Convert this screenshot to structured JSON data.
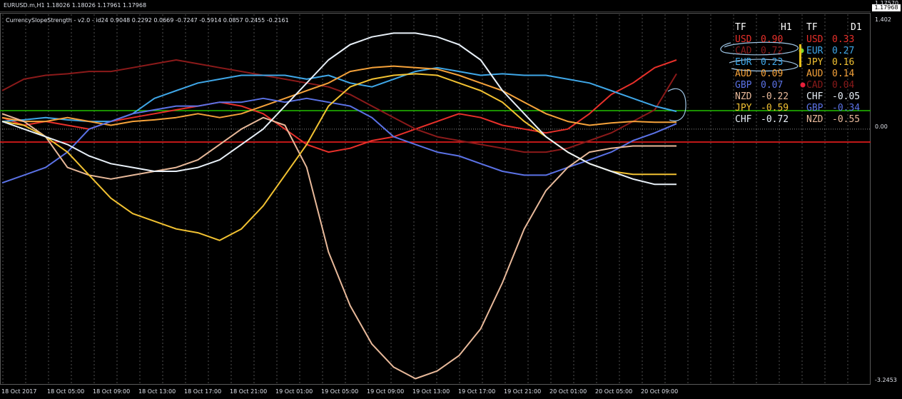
{
  "header": {
    "symbol_line": "EURUSD.m,H1  1.18026 1.18026 1.17961 1.17968",
    "current_price": "1.17968",
    "upper_scale_label": "1.17570"
  },
  "indicator": {
    "title": "CurrencySlopeStrength - v2.0 - id24 0.9048 0.2292 0.0669 -0.7247 -0.5914 0.0857 0.2455 -0.2161",
    "scale_top": "1.402",
    "scale_zero": "0.00",
    "scale_bottom": "-3.2453"
  },
  "time_axis": [
    "18 Oct 2017",
    "18 Oct 05:00",
    "18 Oct 09:00",
    "18 Oct 13:00",
    "18 Oct 17:00",
    "18 Oct 21:00",
    "19 Oct 01:00",
    "19 Oct 05:00",
    "19 Oct 09:00",
    "19 Oct 13:00",
    "19 Oct 17:00",
    "19 Oct 21:00",
    "20 Oct 01:00",
    "20 Oct 05:00",
    "20 Oct 09:00"
  ],
  "table": {
    "headers": [
      "TF",
      "H1",
      "TF",
      "D1"
    ],
    "h1": [
      {
        "cur": "USD",
        "val": "0.90",
        "color": "#e8302a"
      },
      {
        "cur": "CAD",
        "val": "0.72",
        "color": "#8b1a1a"
      },
      {
        "cur": "EUR",
        "val": "0.23",
        "color": "#3fa7e8"
      },
      {
        "cur": "AUD",
        "val": "0.09",
        "color": "#f5a23a"
      },
      {
        "cur": "GBP",
        "val": "0.07",
        "color": "#5b72e6"
      },
      {
        "cur": "NZD",
        "val": "-0.22",
        "color": "#e8b99a"
      },
      {
        "cur": "JPY",
        "val": "-0.59",
        "color": "#f2c232"
      },
      {
        "cur": "CHF",
        "val": "-0.72",
        "color": "#e8f0f8"
      }
    ],
    "d1": [
      {
        "cur": "USD",
        "val": "0.33",
        "color": "#e8302a"
      },
      {
        "cur": "EUR",
        "val": "0.27",
        "color": "#3fa7e8"
      },
      {
        "cur": "JPY",
        "val": "0.16",
        "color": "#f2c232"
      },
      {
        "cur": "AUD",
        "val": "0.14",
        "color": "#f5a23a"
      },
      {
        "cur": "CAD",
        "val": "0.04",
        "color": "#8b1a1a"
      },
      {
        "cur": "CHF",
        "val": "-0.05",
        "color": "#e8f0f8"
      },
      {
        "cur": "GBP",
        "val": "-0.34",
        "color": "#5b72e6"
      },
      {
        "cur": "NZD",
        "val": "-0.55",
        "color": "#e8b99a"
      }
    ]
  },
  "colors": {
    "background": "#000000",
    "grid": "#505050",
    "green_line": "#22c000",
    "red_line": "#ff2020",
    "zero_line": "#888888"
  },
  "chart_data": {
    "type": "line",
    "title": "CurrencySlopeStrength - v2.0 - id24 0.9048 0.2292 0.0669 -0.7247 -0.5914 0.0857 0.2455 -0.2161",
    "ylim": [
      -3.2453,
      1.402
    ],
    "series": [
      {
        "name": "USD",
        "color": "#e8302a",
        "values": [
          0.15,
          0.05,
          0.1,
          0.05,
          0.0,
          0.1,
          0.15,
          0.2,
          0.25,
          0.3,
          0.35,
          0.3,
          0.2,
          0.0,
          -0.2,
          -0.3,
          -0.25,
          -0.15,
          -0.1,
          0.0,
          0.1,
          0.2,
          0.15,
          0.05,
          0.0,
          -0.05,
          0.0,
          0.2,
          0.45,
          0.6,
          0.8,
          0.9
        ]
      },
      {
        "name": "CAD",
        "color": "#8b1a1a",
        "values": [
          0.5,
          0.65,
          0.7,
          0.72,
          0.75,
          0.75,
          0.8,
          0.85,
          0.9,
          0.85,
          0.8,
          0.75,
          0.7,
          0.65,
          0.6,
          0.55,
          0.45,
          0.3,
          0.15,
          0.0,
          -0.1,
          -0.15,
          -0.2,
          -0.25,
          -0.3,
          -0.3,
          -0.25,
          -0.15,
          -0.05,
          0.1,
          0.25,
          0.72
        ]
      },
      {
        "name": "EUR",
        "color": "#3fa7e8",
        "values": [
          0.1,
          0.12,
          0.15,
          0.12,
          0.1,
          0.1,
          0.2,
          0.4,
          0.5,
          0.6,
          0.65,
          0.7,
          0.7,
          0.7,
          0.65,
          0.7,
          0.6,
          0.55,
          0.65,
          0.75,
          0.8,
          0.75,
          0.7,
          0.72,
          0.7,
          0.7,
          0.65,
          0.6,
          0.5,
          0.4,
          0.3,
          0.23
        ]
      },
      {
        "name": "AUD",
        "color": "#f5a23a",
        "values": [
          0.15,
          0.1,
          0.1,
          0.15,
          0.1,
          0.05,
          0.1,
          0.12,
          0.15,
          0.2,
          0.15,
          0.2,
          0.3,
          0.4,
          0.5,
          0.6,
          0.75,
          0.8,
          0.82,
          0.8,
          0.78,
          0.7,
          0.6,
          0.5,
          0.35,
          0.2,
          0.1,
          0.05,
          0.08,
          0.1,
          0.09,
          0.09
        ]
      },
      {
        "name": "GBP",
        "color": "#5b72e6",
        "values": [
          -0.7,
          -0.6,
          -0.5,
          -0.3,
          0.0,
          0.1,
          0.2,
          0.25,
          0.3,
          0.3,
          0.35,
          0.35,
          0.4,
          0.35,
          0.4,
          0.35,
          0.3,
          0.15,
          -0.1,
          -0.2,
          -0.3,
          -0.35,
          -0.45,
          -0.55,
          -0.6,
          -0.6,
          -0.5,
          -0.4,
          -0.3,
          -0.15,
          -0.05,
          0.07
        ]
      },
      {
        "name": "NZD",
        "color": "#e8b99a",
        "values": [
          0.2,
          0.1,
          -0.1,
          -0.5,
          -0.6,
          -0.65,
          -0.6,
          -0.55,
          -0.5,
          -0.4,
          -0.2,
          0.0,
          0.15,
          0.05,
          -0.5,
          -1.6,
          -2.3,
          -2.8,
          -3.1,
          -3.25,
          -3.15,
          -2.95,
          -2.6,
          -2.0,
          -1.3,
          -0.8,
          -0.5,
          -0.3,
          -0.25,
          -0.22,
          -0.22,
          -0.22
        ]
      },
      {
        "name": "JPY",
        "color": "#f2c232",
        "values": [
          0.1,
          0.05,
          -0.1,
          -0.3,
          -0.6,
          -0.9,
          -1.1,
          -1.2,
          -1.3,
          -1.35,
          -1.45,
          -1.3,
          -1.0,
          -0.6,
          -0.2,
          0.3,
          0.55,
          0.65,
          0.7,
          0.72,
          0.7,
          0.6,
          0.5,
          0.35,
          0.1,
          -0.1,
          -0.3,
          -0.45,
          -0.55,
          -0.59,
          -0.59,
          -0.59
        ]
      },
      {
        "name": "CHF",
        "color": "#e8f0f8",
        "values": [
          0.1,
          0.0,
          -0.1,
          -0.2,
          -0.35,
          -0.45,
          -0.5,
          -0.55,
          -0.55,
          -0.5,
          -0.4,
          -0.2,
          0.0,
          0.3,
          0.6,
          0.9,
          1.1,
          1.2,
          1.25,
          1.25,
          1.2,
          1.1,
          0.9,
          0.5,
          0.2,
          -0.1,
          -0.3,
          -0.45,
          -0.55,
          -0.65,
          -0.72,
          -0.72
        ]
      }
    ]
  }
}
